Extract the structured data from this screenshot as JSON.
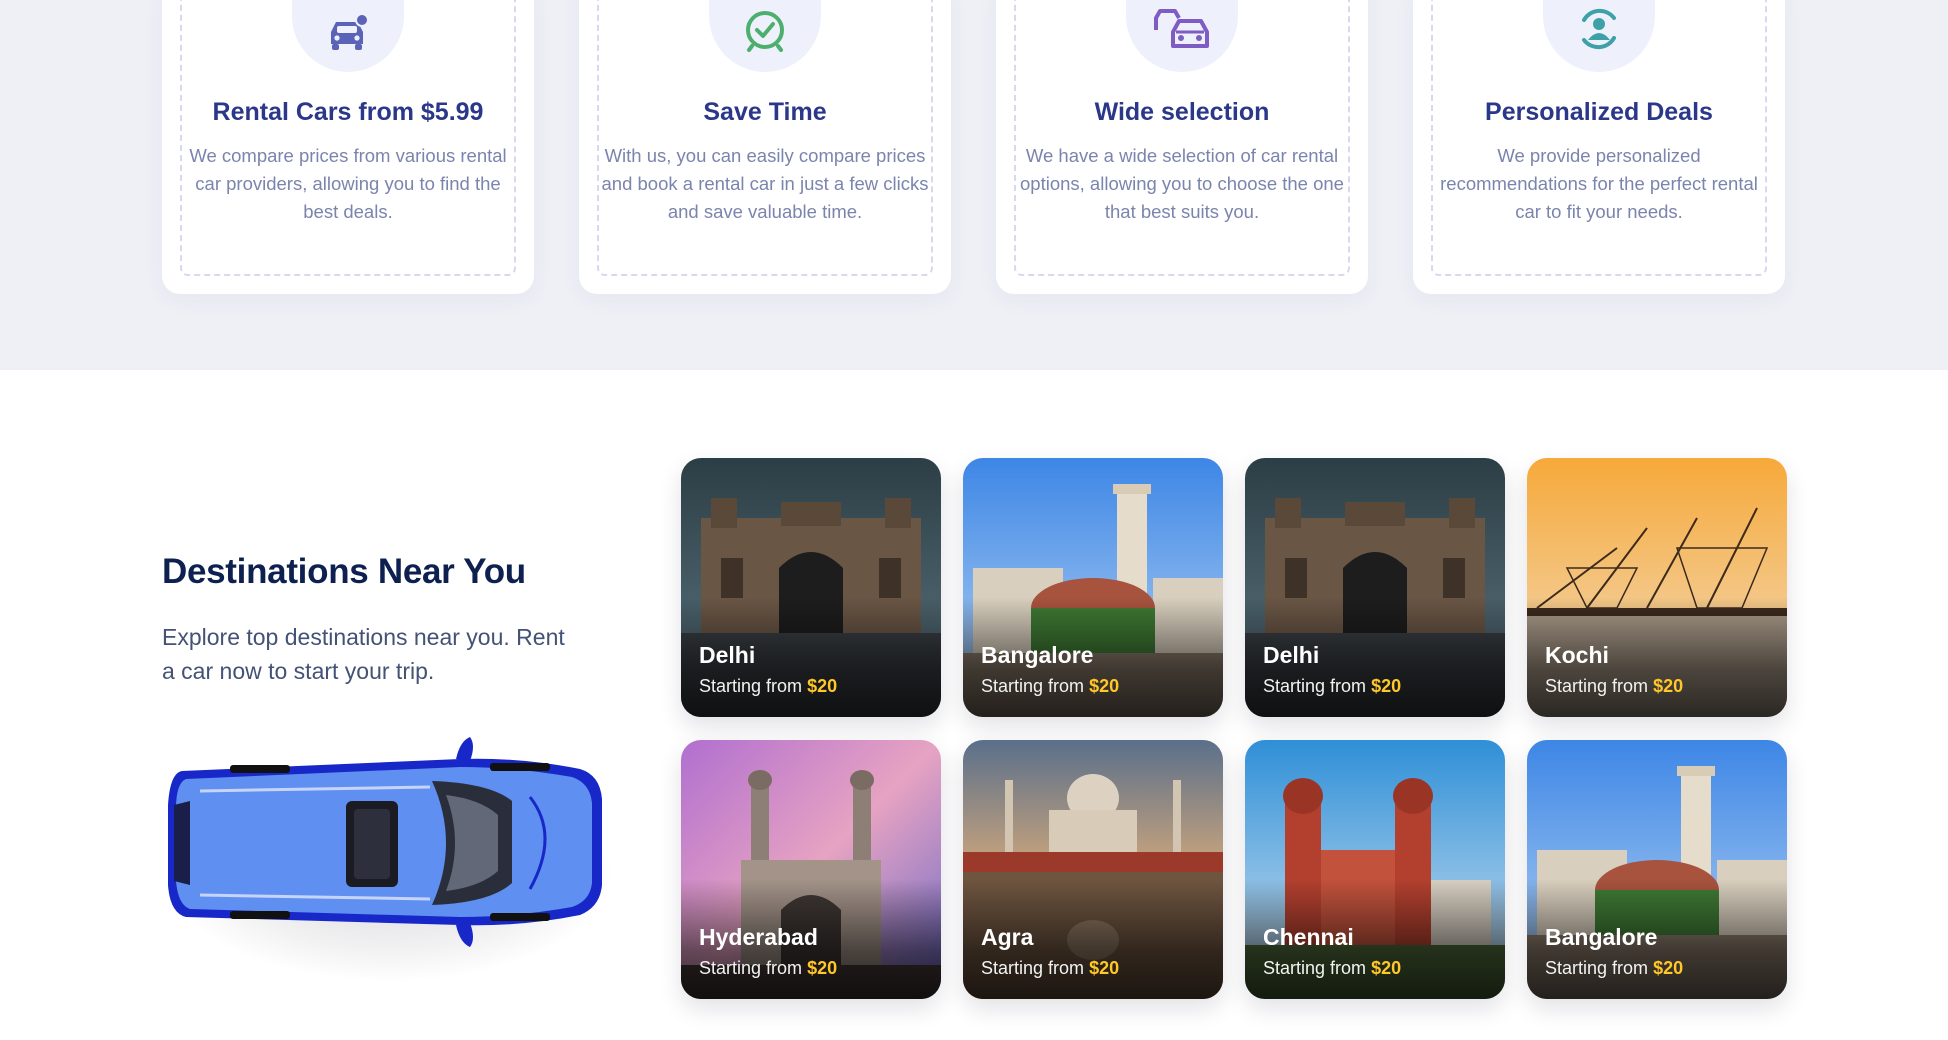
{
  "features": [
    {
      "icon": "car-rental-icon",
      "title": "Rental Cars from $5.99",
      "desc": "We compare prices from various rental car providers, allowing you to find the best deals.",
      "color": "#5a63b8"
    },
    {
      "icon": "check-clock-icon",
      "title": "Save Time",
      "desc": "With us, you can easily compare prices and book a rental car in just a few clicks and save valuable time.",
      "color": "#4caf6e"
    },
    {
      "icon": "car-selection-icon",
      "title": "Wide selection",
      "desc": "We have a wide selection of car rental options, allowing you to choose the one that best suits you.",
      "color": "#7f5cc4"
    },
    {
      "icon": "personalized-user-icon",
      "title": "Personalized Deals",
      "desc": "We provide personalized recommendations for the perfect rental car to fit your needs.",
      "color": "#3ea1a8"
    }
  ],
  "destinations_section": {
    "title": "Destinations Near You",
    "subtitle": "Explore top destinations near you. Rent a car now to start your trip."
  },
  "destinations": [
    {
      "name": "Delhi",
      "prefix": "Starting from",
      "price": "$20"
    },
    {
      "name": "Bangalore",
      "prefix": "Starting from",
      "price": "$20"
    },
    {
      "name": "Delhi",
      "prefix": "Starting from",
      "price": "$20"
    },
    {
      "name": "Kochi",
      "prefix": "Starting from",
      "price": "$20"
    },
    {
      "name": "Hyderabad",
      "prefix": "Starting from",
      "price": "$20"
    },
    {
      "name": "Agra",
      "prefix": "Starting from",
      "price": "$20"
    },
    {
      "name": "Chennai",
      "prefix": "Starting from",
      "price": "$20"
    },
    {
      "name": "Bangalore",
      "prefix": "Starting from",
      "price": "$20"
    }
  ],
  "colors": {
    "heading": "#0d2050",
    "feature_title": "#2b3789",
    "price_accent": "#ffc727",
    "band_bg": "#eff0f6"
  }
}
